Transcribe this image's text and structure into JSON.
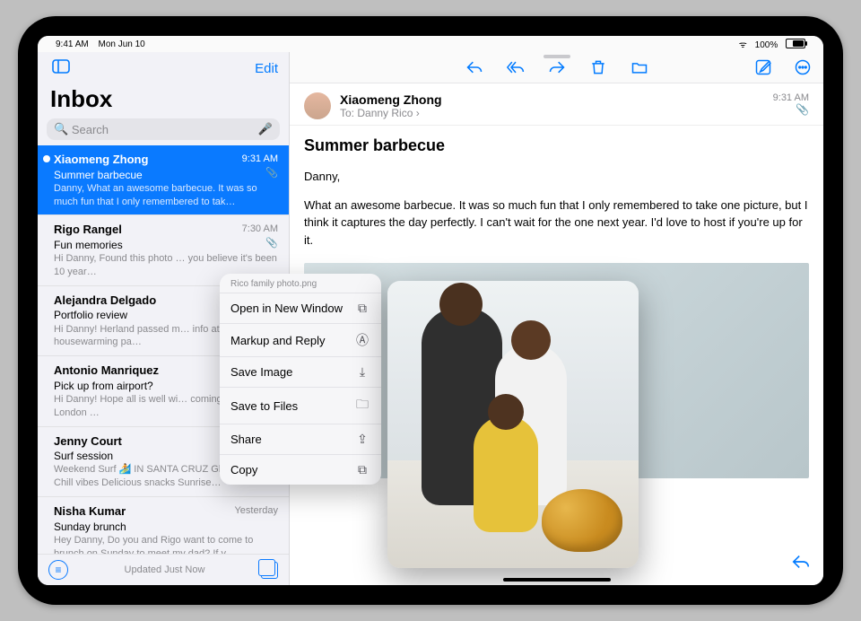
{
  "statusbar": {
    "time": "9:41 AM",
    "date": "Mon Jun 10",
    "battery_pct": "100%"
  },
  "sidebar": {
    "edit": "Edit",
    "title": "Inbox",
    "search_placeholder": "Search",
    "messages": [
      {
        "sender": "Xiaomeng Zhong",
        "time": "9:31 AM",
        "subject": "Summer barbecue",
        "preview": "Danny, What an awesome barbecue. It was so much fun that I only remembered to tak…",
        "has_attachment": true,
        "selected": true
      },
      {
        "sender": "Rigo Rangel",
        "time": "7:30 AM",
        "subject": "Fun memories",
        "preview": "Hi Danny, Found this photo … you believe it's been 10 year…",
        "has_attachment": true,
        "selected": false
      },
      {
        "sender": "Alejandra Delgado",
        "time": "",
        "subject": "Portfolio review",
        "preview": "Hi Danny! Herland passed m… info at his housewarming pa…",
        "has_attachment": false,
        "selected": false
      },
      {
        "sender": "Antonio Manriquez",
        "time": "",
        "subject": "Pick up from airport?",
        "preview": "Hi Danny! Hope all is well wi… coming home from London …",
        "has_attachment": false,
        "selected": false
      },
      {
        "sender": "Jenny Court",
        "time": "",
        "subject": "Surf session",
        "preview": "Weekend Surf 🏄 IN SANTA CRUZ Glassy waves Chill vibes Delicious snacks Sunrise…",
        "has_attachment": false,
        "selected": false
      },
      {
        "sender": "Nisha Kumar",
        "time": "Yesterday",
        "subject": "Sunday brunch",
        "preview": "Hey Danny, Do you and Rigo want to come to brunch on Sunday to meet my dad? If y…",
        "has_attachment": false,
        "selected": false
      }
    ],
    "status": "Updated Just Now"
  },
  "reader": {
    "from": "Xiaomeng Zhong",
    "to_label": "To:",
    "to_name": "Danny Rico",
    "time": "9:31 AM",
    "subject": "Summer barbecue",
    "greeting": "Danny,",
    "body": "What an awesome barbecue. It was so much fun that I only remembered to take one picture, but I think it captures the day perfectly. I can't wait for the one next year. I'd love to host if you're up for it."
  },
  "context_menu": {
    "filename": "Rico family photo.png",
    "items": [
      {
        "label": "Open in New Window",
        "icon": "window-icon"
      },
      {
        "label": "Markup and Reply",
        "icon": "markup-icon"
      },
      {
        "label": "Save Image",
        "icon": "save-down-icon"
      },
      {
        "label": "Save to Files",
        "icon": "folder-icon"
      },
      {
        "label": "Share",
        "icon": "share-up-icon"
      },
      {
        "label": "Copy",
        "icon": "copy-icon"
      }
    ]
  }
}
